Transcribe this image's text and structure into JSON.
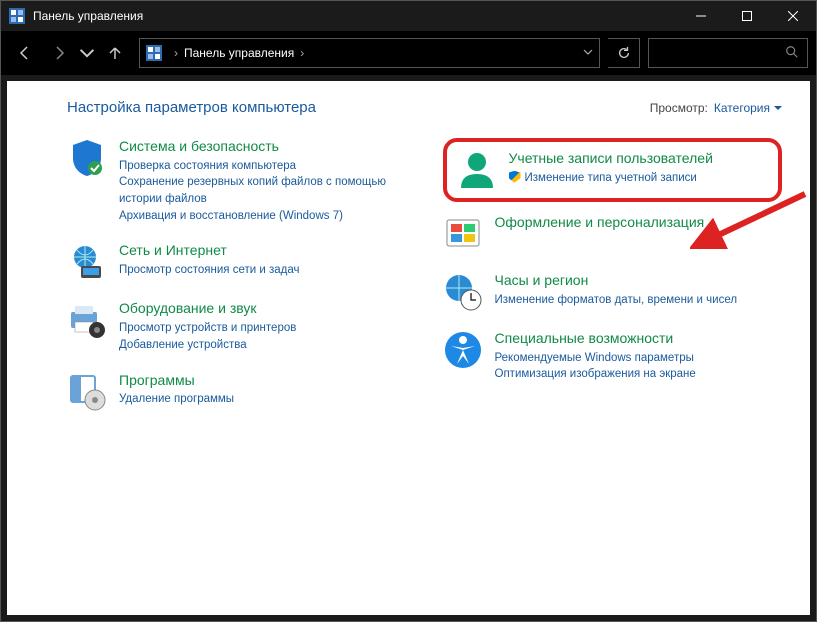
{
  "window": {
    "title": "Панель управления"
  },
  "address": {
    "root": "",
    "crumb": "Панель управления"
  },
  "heading": "Настройка параметров компьютера",
  "view": {
    "label": "Просмотр:",
    "value": "Категория"
  },
  "left": [
    {
      "title": "Система и безопасность",
      "links": [
        "Проверка состояния компьютера",
        "Сохранение резервных копий файлов с помощью истории файлов",
        "Архивация и восстановление (Windows 7)"
      ]
    },
    {
      "title": "Сеть и Интернет",
      "links": [
        "Просмотр состояния сети и задач"
      ]
    },
    {
      "title": "Оборудование и звук",
      "links": [
        "Просмотр устройств и принтеров",
        "Добавление устройства"
      ]
    },
    {
      "title": "Программы",
      "links": [
        "Удаление программы"
      ]
    }
  ],
  "right": [
    {
      "title": "Учетные записи пользователей",
      "links": [
        "Изменение типа учетной записи"
      ],
      "shield": true,
      "highlight": true
    },
    {
      "title": "Оформление и персонализация",
      "links": []
    },
    {
      "title": "Часы и регион",
      "links": [
        "Изменение форматов даты, времени и чисел"
      ]
    },
    {
      "title": "Специальные возможности",
      "links": [
        "Рекомендуемые Windows параметры",
        "Оптимизация изображения на экране"
      ]
    }
  ]
}
